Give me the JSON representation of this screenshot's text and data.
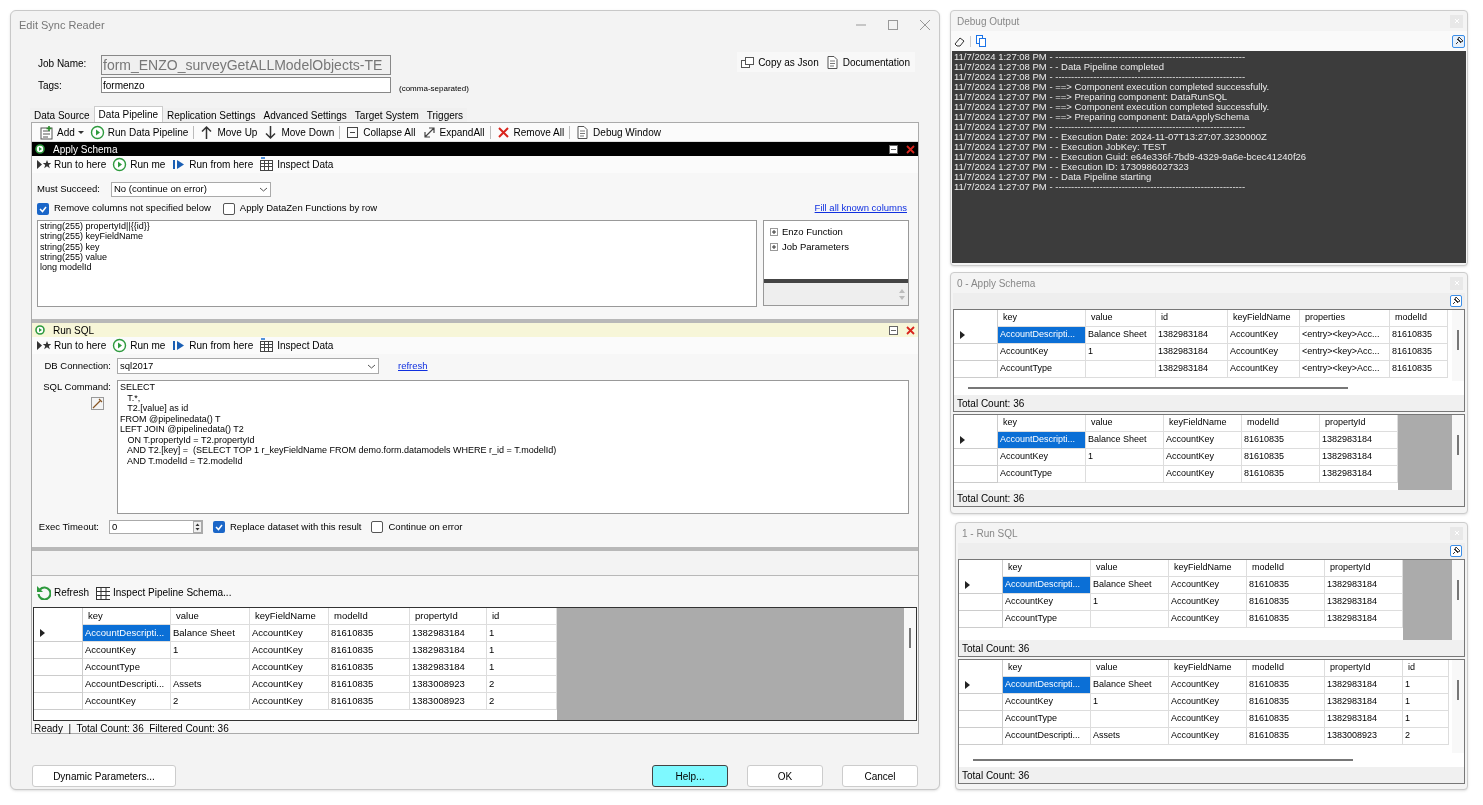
{
  "dialog": {
    "title": "Edit Sync Reader",
    "job_name_label": "Job Name:",
    "job_name": {
      "value": "form_ENZO_surveyGetALLModelObjects-TE",
      "disabled": true
    },
    "tags_label": "Tags:",
    "tags": "formenzo",
    "tags_hint": "(comma-separated)",
    "header_buttons": [
      {
        "label": "Copy as Json"
      },
      {
        "label": "Documentation"
      }
    ]
  },
  "tabs": [
    {
      "label": "Data Source",
      "selected": false
    },
    {
      "label": "Data Pipeline",
      "selected": true
    },
    {
      "label": "Replication Settings",
      "selected": false
    },
    {
      "label": "Advanced Settings",
      "selected": false
    },
    {
      "label": "Target System",
      "selected": false
    },
    {
      "label": "Triggers",
      "selected": false
    }
  ],
  "toolbar": [
    [
      {
        "label": "Add",
        "dropdown": true
      },
      {
        "label": "Run Data Pipeline",
        "dropdown": false
      }
    ],
    [
      {
        "label": "Move Up",
        "dropdown": false
      },
      {
        "label": "Move Down",
        "dropdown": false
      }
    ],
    [
      {
        "label": "Collapse All",
        "dropdown": false
      },
      {
        "label": "ExpandAll",
        "dropdown": false
      }
    ],
    [
      {
        "label": "Remove All",
        "dropdown": false
      }
    ],
    [
      {
        "label": "Debug Window",
        "dropdown": false
      }
    ]
  ],
  "components": [
    {
      "kind": "schema",
      "title": "Apply Schema",
      "selected": true,
      "actions": [
        "Run to here",
        "Run me",
        "Run from here",
        "Inspect Data"
      ],
      "must_succeed_label": "Must Succeed:",
      "must_succeed": "No (continue on error)",
      "options": [
        {
          "label": "Remove columns not specified below",
          "checked": true
        },
        {
          "label": "Apply DataZen Functions by row",
          "checked": false
        }
      ],
      "link": "Fill all known columns",
      "schema_lines": [
        "string(255) propertyId||{{id}}",
        "string(255) keyFieldName",
        "string(255) key",
        "string(255) value",
        "long modelId"
      ],
      "tree": [
        {
          "label": "Enzo Function",
          "expanded": false
        },
        {
          "label": "Job Parameters",
          "expanded": false
        }
      ]
    },
    {
      "kind": "sql",
      "title": "Run SQL",
      "selected": false,
      "actions": [
        "Run to here",
        "Run me",
        "Run from here",
        "Inspect Data"
      ],
      "connection_label": "DB Connection:",
      "connection": "sql2017",
      "link": "refresh",
      "command_label": "SQL Command:",
      "sql_lines": [
        "SELECT",
        "   T.*,",
        "   T2.[value] as id",
        "FROM @pipelinedata() T",
        "LEFT JOIN @pipelinedata() T2",
        "   ON T.propertyId = T2.propertyId",
        "   AND T2.[key] =  (SELECT TOP 1 r_keyFieldName FROM demo.form.datamodels WHERE r_id = T.modelId)",
        "   AND T.modelId = T2.modelId"
      ],
      "timeout_label": "Exec Timeout:",
      "timeout": "0",
      "options": [
        {
          "label": "Replace dataset with this result",
          "checked": true
        },
        {
          "label": "Continue on error",
          "checked": false
        }
      ]
    }
  ],
  "results": {
    "actions": [
      "Refresh",
      "Inspect Pipeline Schema..."
    ],
    "grid": {
      "columns": [
        "key",
        "value",
        "keyFieldName",
        "modelId",
        "propertyId",
        "id"
      ],
      "rows": [
        {
          "selected": true,
          "cells": [
            "AccountDescripti...",
            "Balance Sheet",
            "AccountKey",
            "81610835",
            "1382983184",
            "1"
          ]
        },
        {
          "selected": false,
          "cells": [
            "AccountKey",
            "1",
            "AccountKey",
            "81610835",
            "1382983184",
            "1"
          ]
        },
        {
          "selected": false,
          "cells": [
            "AccountType",
            null,
            "AccountKey",
            "81610835",
            "1382983184",
            "1"
          ]
        },
        {
          "selected": false,
          "cells": [
            "AccountDescripti...",
            "Assets",
            "AccountKey",
            "81610835",
            "1383008923",
            "2"
          ]
        },
        {
          "selected": false,
          "cells": [
            "AccountKey",
            "2",
            "AccountKey",
            "81610835",
            "1383008923",
            "2"
          ]
        }
      ]
    },
    "status": "Ready  |  Total Count: 36  Filtered Count: 36"
  },
  "footer_buttons": [
    {
      "label": "Dynamic Parameters...",
      "highlighted": false
    },
    {
      "label": "Help...",
      "highlighted": true
    },
    {
      "label": "OK",
      "highlighted": false
    },
    {
      "label": "Cancel",
      "highlighted": false
    }
  ],
  "debug_output": {
    "title": "Debug Output",
    "lines": [
      "11/7/2024 1:27:08 PM - ------------------------------------------------------------",
      "11/7/2024 1:27:08 PM - - Data Pipeline completed",
      "11/7/2024 1:27:08 PM - ------------------------------------------------------------",
      "11/7/2024 1:27:08 PM - ==> Component execution completed successfully.",
      "11/7/2024 1:27:07 PM - ==> Preparing component: DataRunSQL",
      "11/7/2024 1:27:07 PM - ==> Component execution completed successfully.",
      "11/7/2024 1:27:07 PM - ==> Preparing component: DataApplySchema",
      "11/7/2024 1:27:07 PM - ------------------------------------------------------------",
      "11/7/2024 1:27:07 PM - - Execution Date: 2024-11-07T13:27:07.3230000Z",
      "11/7/2024 1:27:07 PM - - Execution JobKey: TEST",
      "11/7/2024 1:27:07 PM - - Execution Guid: e64e336f-7bd9-4329-9a6e-bcec41240f26",
      "11/7/2024 1:27:07 PM - - Execution ID: 1730986027323",
      "11/7/2024 1:27:07 PM - - Data Pipeline starting",
      "11/7/2024 1:27:07 PM - ------------------------------------------------------------"
    ]
  },
  "inspect_panels": [
    {
      "title": "0 - Apply Schema",
      "grids": [
        {
          "columns": [
            "key",
            "value",
            "id",
            "keyFieldName",
            "properties",
            "modelId"
          ],
          "total": "Total Count: 36",
          "rows": [
            {
              "selected": true,
              "cells": [
                "AccountDescripti...",
                "Balance Sheet",
                "1382983184",
                "AccountKey",
                "<entry><key>Acc...",
                "81610835"
              ]
            },
            {
              "selected": false,
              "cells": [
                "AccountKey",
                "1",
                "1382983184",
                "AccountKey",
                "<entry><key>Acc...",
                "81610835"
              ]
            },
            {
              "selected": false,
              "cells": [
                "AccountType",
                null,
                "1382983184",
                "AccountKey",
                "<entry><key>Acc...",
                "81610835"
              ]
            }
          ]
        },
        {
          "columns": [
            "key",
            "value",
            "keyFieldName",
            "modelId",
            "propertyId"
          ],
          "total": "Total Count: 36",
          "rows": [
            {
              "selected": true,
              "cells": [
                "AccountDescripti...",
                "Balance Sheet",
                "AccountKey",
                "81610835",
                "1382983184"
              ]
            },
            {
              "selected": false,
              "cells": [
                "AccountKey",
                "1",
                "AccountKey",
                "81610835",
                "1382983184"
              ]
            },
            {
              "selected": false,
              "cells": [
                "AccountType",
                null,
                "AccountKey",
                "81610835",
                "1382983184"
              ]
            }
          ]
        }
      ]
    },
    {
      "title": "1 - Run SQL",
      "grids": [
        {
          "columns": [
            "key",
            "value",
            "keyFieldName",
            "modelId",
            "propertyId"
          ],
          "total": "Total Count: 36",
          "rows": [
            {
              "selected": true,
              "cells": [
                "AccountDescripti...",
                "Balance Sheet",
                "AccountKey",
                "81610835",
                "1382983184"
              ]
            },
            {
              "selected": false,
              "cells": [
                "AccountKey",
                "1",
                "AccountKey",
                "81610835",
                "1382983184"
              ]
            },
            {
              "selected": false,
              "cells": [
                "AccountType",
                null,
                "AccountKey",
                "81610835",
                "1382983184"
              ]
            }
          ]
        },
        {
          "columns": [
            "key",
            "value",
            "keyFieldName",
            "modelId",
            "propertyId",
            "id"
          ],
          "total": "Total Count: 36",
          "rows": [
            {
              "selected": true,
              "cells": [
                "AccountDescripti...",
                "Balance Sheet",
                "AccountKey",
                "81610835",
                "1382983184",
                "1"
              ]
            },
            {
              "selected": false,
              "cells": [
                "AccountKey",
                "1",
                "AccountKey",
                "81610835",
                "1382983184",
                "1"
              ]
            },
            {
              "selected": false,
              "cells": [
                "AccountType",
                null,
                "AccountKey",
                "81610835",
                "1382983184",
                "1"
              ]
            },
            {
              "selected": false,
              "cells": [
                "AccountDescripti...",
                "Assets",
                "AccountKey",
                "81610835",
                "1383008923",
                "2"
              ]
            }
          ]
        }
      ]
    }
  ]
}
